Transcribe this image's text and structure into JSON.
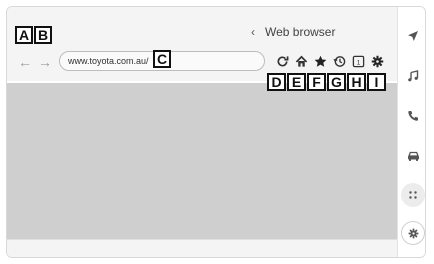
{
  "header": {
    "title": "Web browser"
  },
  "toolbar": {
    "url": "www.toyota.com.au/"
  },
  "callouts": {
    "a": "A",
    "b": "B",
    "c": "C",
    "d": "D",
    "e": "E",
    "f": "F",
    "g": "G",
    "h": "H",
    "i": "I"
  },
  "icons": {
    "back": "back-arrow-icon",
    "forward": "forward-arrow-icon",
    "reload": "reload-icon",
    "home": "home-icon",
    "bookmarks": "star-icon",
    "history": "history-icon",
    "tabs": "tabs-icon",
    "settings": "gear-icon",
    "tabs_count": "1"
  },
  "colors": {
    "content_bg": "#cfcfcf",
    "toolbar_bg": "#f4f4f4"
  }
}
